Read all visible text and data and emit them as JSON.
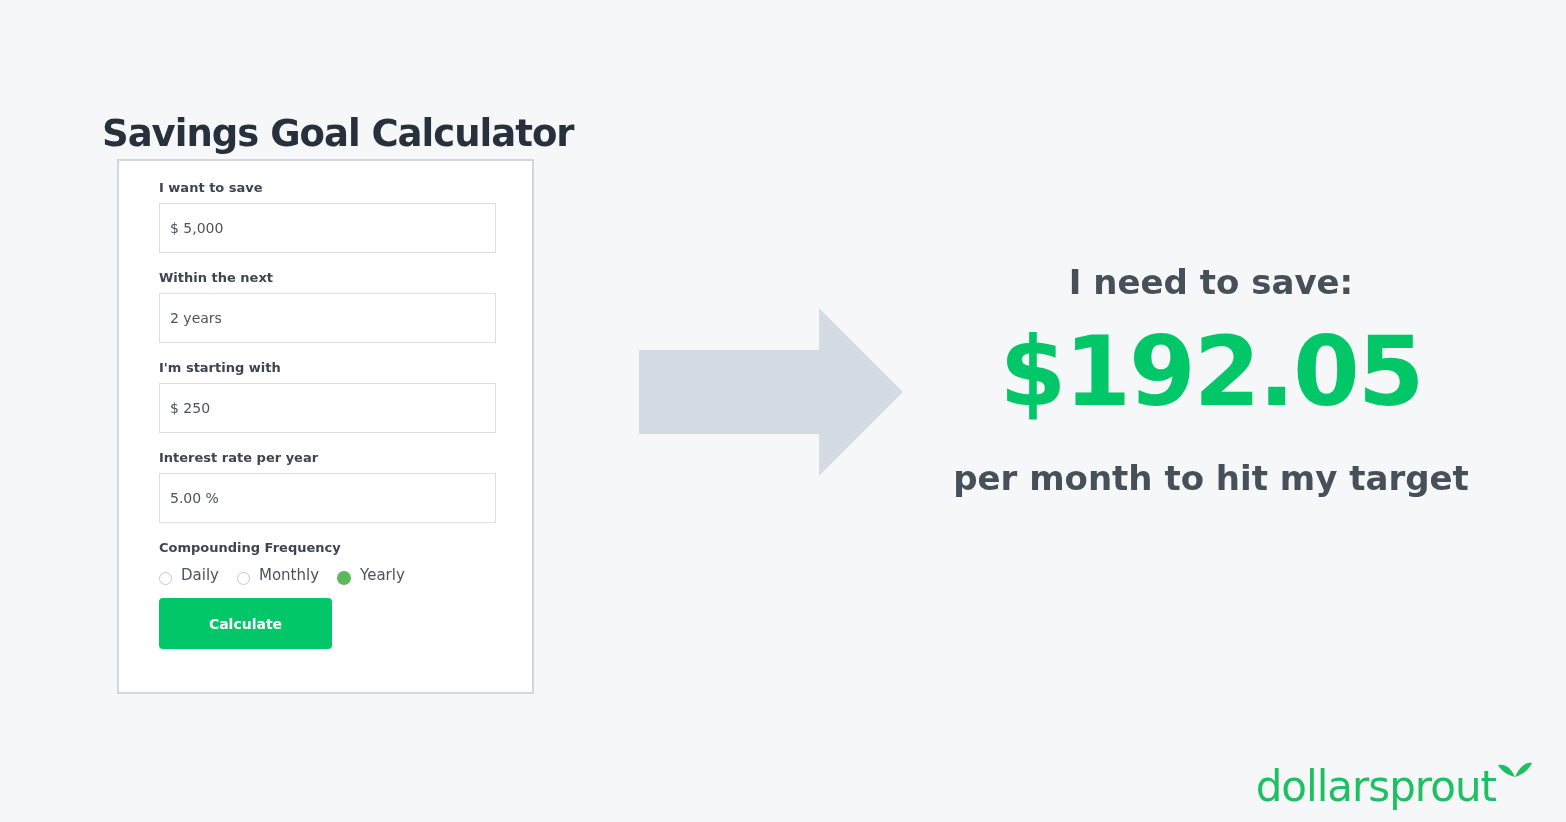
{
  "title": "Savings Goal Calculator",
  "form": {
    "fields": [
      {
        "label": "I want to save",
        "value": "$ 5,000"
      },
      {
        "label": "Within the next",
        "value": "2 years"
      },
      {
        "label": "I'm starting with",
        "value": "$ 250"
      },
      {
        "label": "Interest rate per year",
        "value": "5.00 %"
      }
    ],
    "frequency": {
      "label": "Compounding Frequency",
      "options": [
        {
          "label": "Daily",
          "selected": false
        },
        {
          "label": "Monthly",
          "selected": false
        },
        {
          "label": "Yearly",
          "selected": true
        }
      ]
    },
    "button": "Calculate"
  },
  "result": {
    "heading": "I need to save:",
    "amount": "$192.05",
    "caption": "per month to hit my target"
  },
  "logo": "dollarsprout"
}
